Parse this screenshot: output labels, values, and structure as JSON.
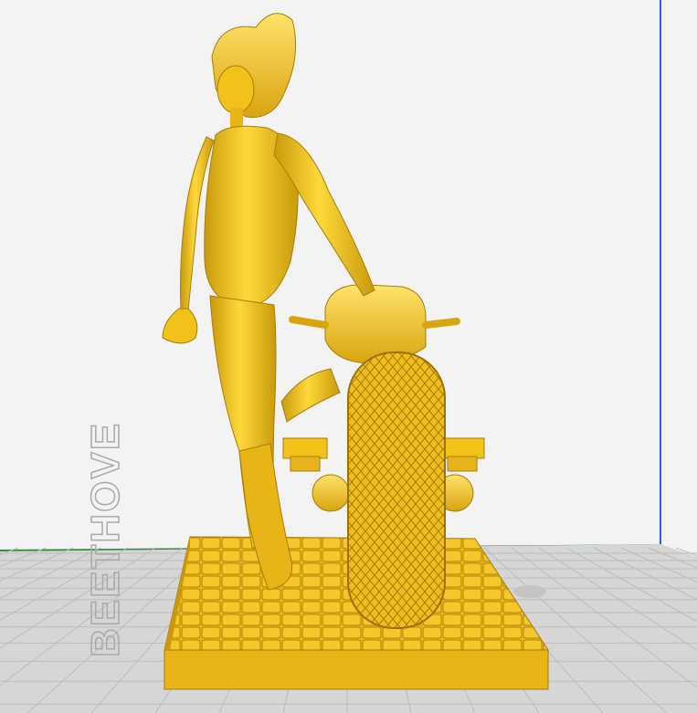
{
  "app": {
    "view": "slicer-3d-viewport",
    "build_plate_label": "BEETHOVE"
  },
  "model": {
    "name": "figure-with-motorcycle-on-cobblestone-base",
    "color": "#f2c21a",
    "shade_color": "#c99a0c",
    "highlight_color": "#ffe36a"
  },
  "colors": {
    "background": "#f3f3f3",
    "bed": "#d2d2d2",
    "grid_line": "#b9b9b9",
    "back_wall_line": "#c8c8c8",
    "axis_blue": "#2c57ff",
    "axis_green": "#2e8b3a"
  }
}
